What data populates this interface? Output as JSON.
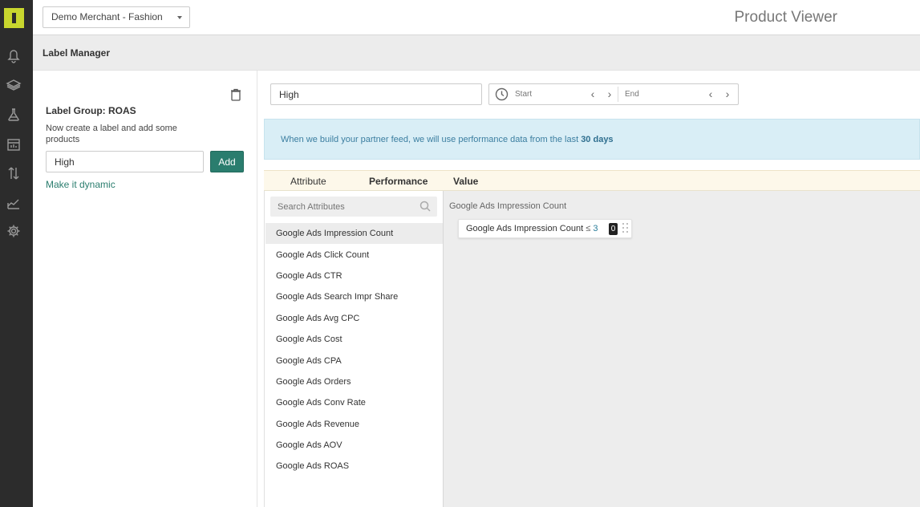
{
  "rail": {
    "items": [
      {
        "name": "notifications",
        "icon": "bell-icon"
      },
      {
        "name": "layers",
        "icon": "layers-icon"
      },
      {
        "name": "lab",
        "icon": "flask-icon"
      },
      {
        "name": "tools",
        "icon": "store-icon"
      },
      {
        "name": "transfers",
        "icon": "arrows-icon"
      },
      {
        "name": "analytics",
        "icon": "chart-icon"
      },
      {
        "name": "settings",
        "icon": "gear-icon"
      }
    ],
    "logo_color": "#c8d62e"
  },
  "header": {
    "merchant_select": "Demo Merchant - Fashion",
    "title": "Product Viewer"
  },
  "label_manager": {
    "title": "Label Manager",
    "group_title": "Label Group: ROAS",
    "hint": "Now create a label and add some products",
    "label_value": "High",
    "add_label": "Add",
    "dynamic_link": "Make it dynamic"
  },
  "editor": {
    "name_value": "High",
    "date_start_placeholder": "Start",
    "date_end_placeholder": "End",
    "info_text": "When we build your partner feed, we will use performance data from the last ",
    "info_bold": "30 days",
    "tabs": [
      "Attribute",
      "Performance",
      "Value"
    ],
    "active_tab": "Performance",
    "search_placeholder": "Search Attributes",
    "attributes": [
      "Google Ads Impression Count",
      "Google Ads Click Count",
      "Google Ads CTR",
      "Google Ads Search Impr Share",
      "Google Ads Avg CPC",
      "Google Ads Cost",
      "Google Ads CPA",
      "Google Ads Orders",
      "Google Ads Conv Rate",
      "Google Ads Revenue",
      "Google Ads AOV",
      "Google Ads ROAS"
    ],
    "selected_attribute": "Google Ads Impression Count",
    "work_title": "Google Ads Impression Count",
    "rule": {
      "attribute": "Google Ads Impression Count",
      "operator": "≤",
      "value": "3",
      "count": "0"
    }
  },
  "colors": {
    "accent": "#2a7d6e",
    "info_bg": "#d9eef6",
    "rail_bg": "#2c2c2c"
  }
}
